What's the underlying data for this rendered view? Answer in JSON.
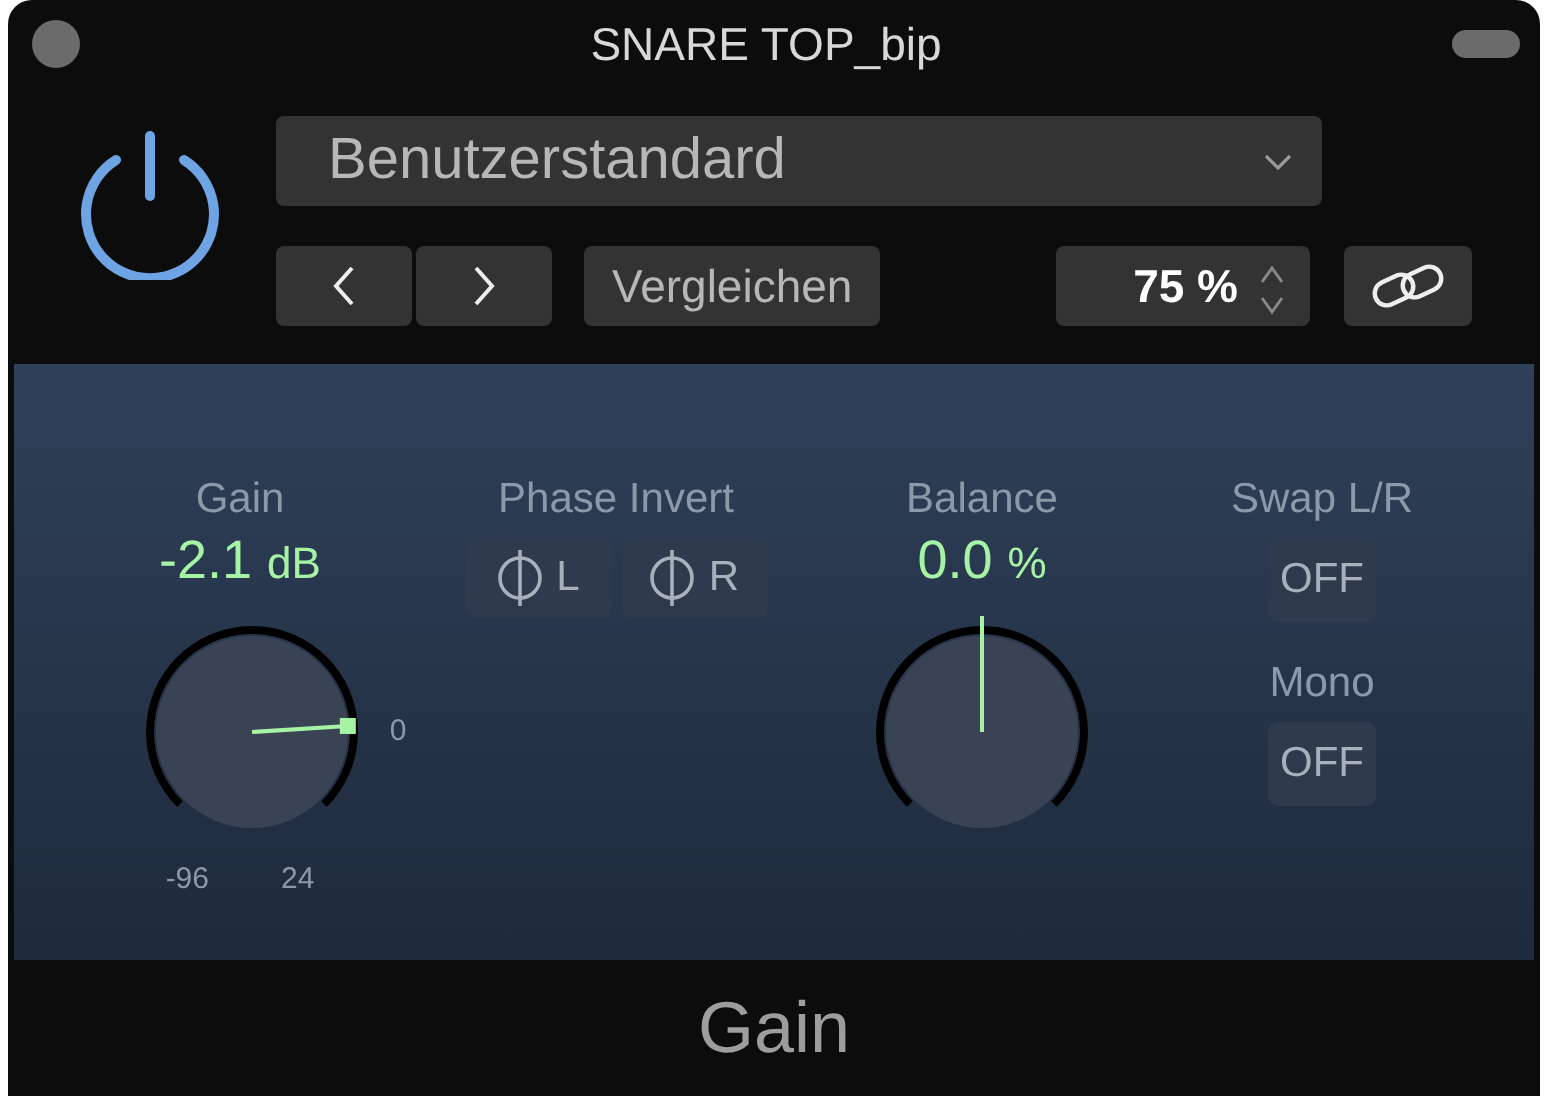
{
  "window": {
    "title": "SNARE TOP_bip"
  },
  "header": {
    "power_on": true,
    "preset": "Benutzerstandard",
    "compare": "Vergleichen",
    "zoom": "75 %",
    "link_on": false
  },
  "controls": [
    {
      "kind": "knob",
      "label": "Gain",
      "value": "-2.1",
      "unit": "dB",
      "marker": "0",
      "min": "-96",
      "max": "24"
    },
    {
      "kind": "toggles",
      "label": "Phase Invert",
      "buttons": [
        {
          "text": "L",
          "on": false
        },
        {
          "text": "R",
          "on": false
        }
      ]
    },
    {
      "kind": "knob",
      "label": "Balance",
      "value": "0.0",
      "unit": "%"
    },
    {
      "kind": "switches",
      "items": [
        {
          "label": "Swap L/R",
          "text": "OFF",
          "on": false
        },
        {
          "label": "Mono",
          "text": "OFF",
          "on": false
        }
      ]
    }
  ],
  "footer": {
    "title": "Gain"
  }
}
